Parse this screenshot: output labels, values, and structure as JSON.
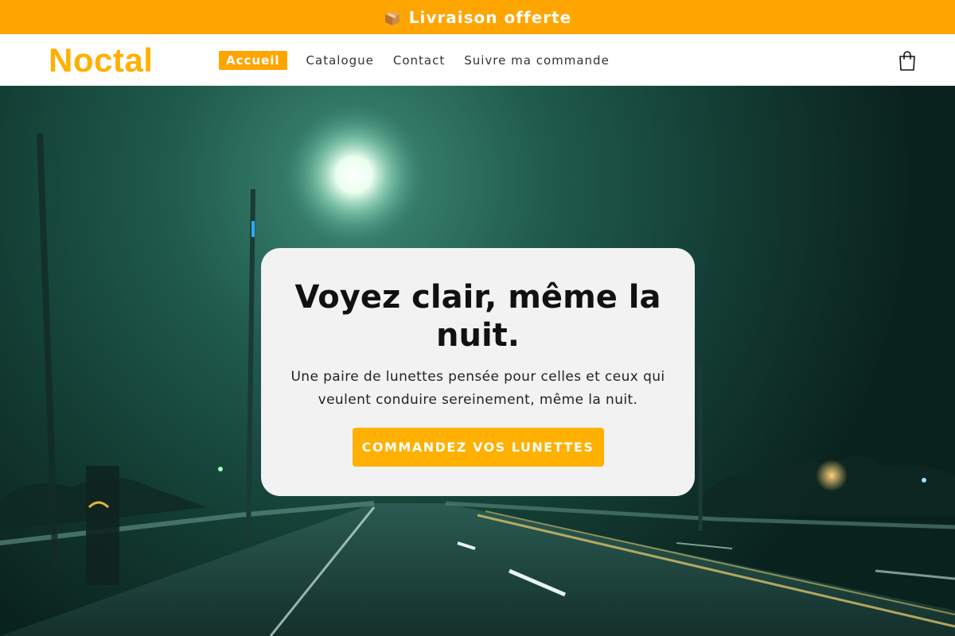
{
  "announcement": {
    "icon": "package-icon",
    "text": "Livraison offerte"
  },
  "header": {
    "logo": "Noctal",
    "nav": [
      {
        "label": "Accueil",
        "active": true
      },
      {
        "label": "Catalogue",
        "active": false
      },
      {
        "label": "Contact",
        "active": false
      },
      {
        "label": "Suivre ma commande",
        "active": false
      }
    ],
    "cart_icon": "shopping-bag-icon"
  },
  "hero": {
    "title": "Voyez clair, même la nuit.",
    "subtitle": "Une paire de lunettes pensée pour celles et ceux qui veulent conduire sereinement, même la nuit.",
    "cta_label": "COMMANDEZ VOS LUNETTES"
  },
  "colors": {
    "accent": "#ffa500",
    "brand": "#ffb000",
    "card_bg": "#f2f2f2"
  }
}
